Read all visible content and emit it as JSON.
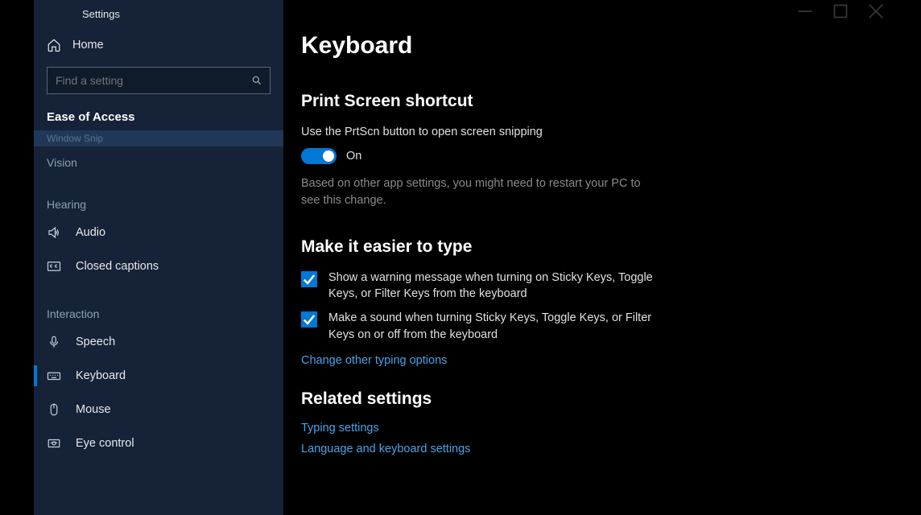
{
  "window": {
    "title": "Settings"
  },
  "sidebar": {
    "home_label": "Home",
    "search_placeholder": "Find a setting",
    "category": "Ease of Access",
    "highlight_text": "Window Snip",
    "groups": [
      {
        "label": "Vision",
        "items": []
      },
      {
        "label": "Hearing",
        "items": [
          {
            "id": "audio",
            "label": "Audio"
          },
          {
            "id": "closed-captions",
            "label": "Closed captions"
          }
        ]
      },
      {
        "label": "Interaction",
        "items": [
          {
            "id": "speech",
            "label": "Speech"
          },
          {
            "id": "keyboard",
            "label": "Keyboard",
            "active": true
          },
          {
            "id": "mouse",
            "label": "Mouse"
          },
          {
            "id": "eye-control",
            "label": "Eye control"
          }
        ]
      }
    ]
  },
  "main": {
    "page_title": "Keyboard",
    "section1": {
      "heading": "Print Screen shortcut",
      "desc": "Use the PrtScn button to open screen snipping",
      "toggle_state": "On",
      "note": "Based on other app settings, you might need to restart your PC to see this change."
    },
    "section2": {
      "heading": "Make it easier to type",
      "check1": "Show a warning message when turning on Sticky Keys, Toggle Keys, or Filter Keys from the keyboard",
      "check2": "Make a sound when turning Sticky Keys, Toggle Keys, or Filter Keys on or off from the keyboard",
      "link": "Change other typing options"
    },
    "section3": {
      "heading": "Related settings",
      "link1": "Typing settings",
      "link2": "Language and keyboard settings"
    }
  }
}
